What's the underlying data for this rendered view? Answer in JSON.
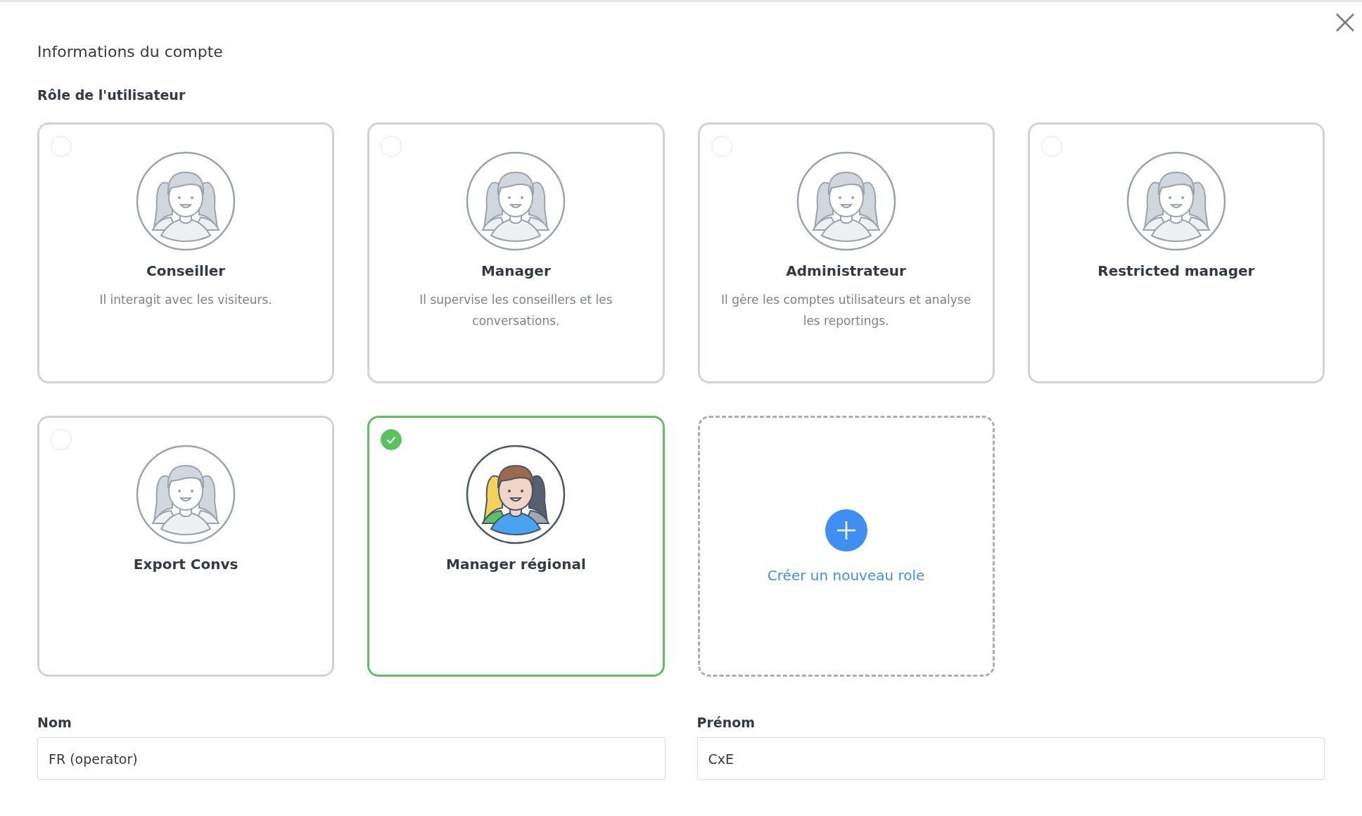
{
  "title": "Informations du compte",
  "role_section": {
    "label": "Rôle de l'utilisateur",
    "roles": [
      {
        "kind": "role",
        "name": "Conseiller",
        "description": "Il interagit avec les visiteurs.",
        "selected": false
      },
      {
        "kind": "role",
        "name": "Manager",
        "description": "Il supervise les conseillers et les conversations.",
        "selected": false
      },
      {
        "kind": "role",
        "name": "Administrateur",
        "description": "Il gère les comptes utilisateurs et analyse les reportings.",
        "selected": false
      },
      {
        "kind": "role",
        "name": "Restricted manager",
        "selected": false
      },
      {
        "kind": "role",
        "name": "Export Convs",
        "selected": false
      },
      {
        "kind": "role",
        "name": "Manager régional",
        "selected": true
      },
      {
        "kind": "create",
        "name": "Créer un nouveau role"
      }
    ]
  },
  "fields": [
    {
      "label": "Nom",
      "value": "FR (operator)"
    },
    {
      "label": "Prénom",
      "value": "CxE"
    }
  ]
}
